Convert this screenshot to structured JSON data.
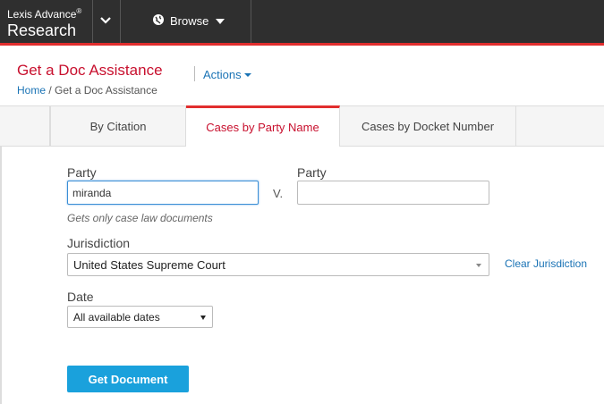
{
  "topbar": {
    "brand_line1": "Lexis Advance",
    "brand_reg": "®",
    "brand_line2": "Research",
    "browse_label": "Browse"
  },
  "header": {
    "title": "Get a Doc Assistance",
    "actions_label": "Actions",
    "breadcrumb_home": "Home",
    "breadcrumb_sep": " / ",
    "breadcrumb_current": "Get a Doc Assistance"
  },
  "tabs": [
    {
      "label": "By Citation",
      "active": false
    },
    {
      "label": "Cases by Party Name",
      "active": true
    },
    {
      "label": "Cases by Docket Number",
      "active": false
    }
  ],
  "form": {
    "party1_label": "Party",
    "party1_value": "miranda",
    "vs_label": "V.",
    "party2_label": "Party",
    "party2_value": "",
    "hint": "Gets only case law documents",
    "jurisdiction_label": "Jurisdiction",
    "jurisdiction_value": "United States Supreme Court",
    "clear_jurisdiction": "Clear Jurisdiction",
    "date_label": "Date",
    "date_value": "All available dates",
    "submit_label": "Get Document"
  },
  "colors": {
    "accent_red": "#e12d2d",
    "title_red": "#c8102e",
    "link_blue": "#1a73b5",
    "button_blue": "#1aa1dc",
    "topbar_bg": "#2f2f2f"
  }
}
